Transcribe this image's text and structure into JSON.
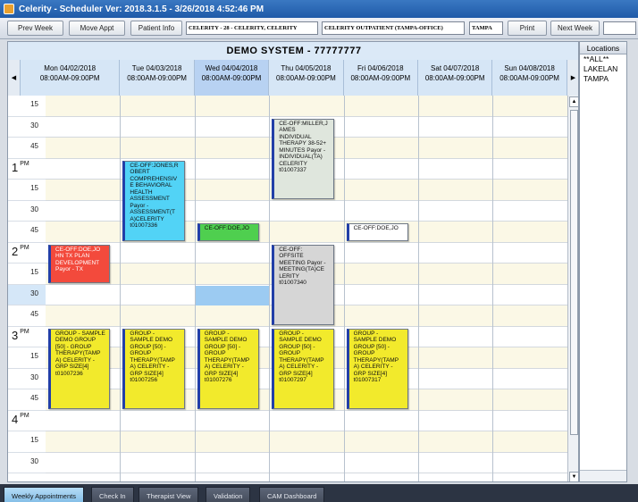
{
  "window": {
    "title": "Celerity - Scheduler Ver: 2018.3.1.5 - 3/26/2018 4:52:46 PM"
  },
  "toolbar": {
    "prev_week": "Prev Week",
    "move_appt": "Move Appt",
    "patient_info": "Patient Info",
    "patient_field": "CELERITY - 28 - CELERITY, CELERITY",
    "facility_field": "CELERITY OUTPATIENT (TAMPA-OFFICE)",
    "location_field": "TAMPA",
    "print": "Print",
    "next_week": "Next Week",
    "search_field": ""
  },
  "scheduler": {
    "system_title": "DEMO SYSTEM - 77777777",
    "days": [
      {
        "date": "Mon 04/02/2018",
        "hours": "08:00AM-09:00PM"
      },
      {
        "date": "Tue 04/03/2018",
        "hours": "08:00AM-09:00PM"
      },
      {
        "date": "Wed 04/04/2018",
        "hours": "08:00AM-09:00PM"
      },
      {
        "date": "Thu 04/05/2018",
        "hours": "08:00AM-09:00PM"
      },
      {
        "date": "Fri 04/06/2018",
        "hours": "08:00AM-09:00PM"
      },
      {
        "date": "Sat 04/07/2018",
        "hours": "08:00AM-09:00PM"
      },
      {
        "date": "Sun 04/08/2018",
        "hours": "08:00AM-09:00PM"
      }
    ],
    "time_slots": [
      {
        "hour": "",
        "ampm": "",
        "min": "15"
      },
      {
        "hour": "",
        "ampm": "",
        "min": "30"
      },
      {
        "hour": "",
        "ampm": "",
        "min": "45"
      },
      {
        "hour": "1",
        "ampm": "PM",
        "min": ""
      },
      {
        "hour": "",
        "ampm": "",
        "min": "15"
      },
      {
        "hour": "",
        "ampm": "",
        "min": "30"
      },
      {
        "hour": "",
        "ampm": "",
        "min": "45"
      },
      {
        "hour": "2",
        "ampm": "PM",
        "min": ""
      },
      {
        "hour": "",
        "ampm": "",
        "min": "15"
      },
      {
        "hour": "",
        "ampm": "",
        "min": "30"
      },
      {
        "hour": "",
        "ampm": "",
        "min": "45"
      },
      {
        "hour": "3",
        "ampm": "PM",
        "min": ""
      },
      {
        "hour": "",
        "ampm": "",
        "min": "15"
      },
      {
        "hour": "",
        "ampm": "",
        "min": "30"
      },
      {
        "hour": "",
        "ampm": "",
        "min": "45"
      },
      {
        "hour": "4",
        "ampm": "PM",
        "min": ""
      },
      {
        "hour": "",
        "ampm": "",
        "min": "15"
      },
      {
        "hour": "",
        "ampm": "",
        "min": "30"
      }
    ],
    "appointments": [
      {
        "id": "a1",
        "text": "CE-OFF:JONES,R\nOBERT\nCOMPREHENSIV\nE BEHAVIORAL\nHEALTH\nASSESSMENT\nPayor -\nASSESSMENT(T\nA)CELERITY\nt01007336",
        "color": "cyan"
      },
      {
        "id": "a2",
        "text": "CE-OFF:MILLER,J\nAMES\nINDIVIDUAL\nTHERAPY 38-52+\nMINUTES Payor -\nINDIVIDUAL(TA)\nCELERITY\nt01007337",
        "color": "graygreen"
      },
      {
        "id": "a3",
        "text": "CE-OFF:DOE,JO",
        "color": "green"
      },
      {
        "id": "a4",
        "text": "CE-OFF:DOE,JO",
        "color": "white"
      },
      {
        "id": "a5",
        "text": "CE-OFF:DOE,JO\nHN TX PLAN\nDEVELOPMENT\nPayor - TX",
        "color": "red"
      },
      {
        "id": "a6",
        "text": "CE-OFF:\nOFFSITE\nMEETING Payor -\nMEETING(TA)CE\nLERITY\nt01007340",
        "color": "gray"
      },
      {
        "id": "a7",
        "text": "GROUP - SAMPLE\nDEMO GROUP\n[50] - GROUP\nTHERAPY(TAMP\nA) CELERITY -\nGRP SIZE[4]\nt01007236",
        "color": "yellow"
      },
      {
        "id": "a8",
        "text": "GROUP -\nSAMPLE DEMO\nGROUP [50] -\nGROUP\nTHERAPY(TAMP\nA) CELERITY -\nGRP SIZE[4]\nt01007256",
        "color": "yellow"
      },
      {
        "id": "a9",
        "text": "GROUP -\nSAMPLE DEMO\nGROUP [50] -\nGROUP\nTHERAPY(TAMP\nA) CELERITY -\nGRP SIZE[4]\nt01007276",
        "color": "yellow"
      },
      {
        "id": "a10",
        "text": "GROUP -\nSAMPLE DEMO\nGROUP [50] -\nGROUP\nTHERAPY(TAMP\nA) CELERITY -\nGRP SIZE[4]\nt01007297",
        "color": "yellow"
      },
      {
        "id": "a11",
        "text": "GROUP -\nSAMPLE DEMO\nGROUP [50] -\nGROUP\nTHERAPY(TAMP\nA) CELERITY -\nGRP SIZE[4]\nt01007317",
        "color": "yellow"
      }
    ]
  },
  "locations": {
    "header": "Locations",
    "items": [
      "**ALL**",
      "LAKELAN",
      "TAMPA"
    ]
  },
  "tabs": [
    {
      "label": "Weekly Appointments"
    },
    {
      "label": "Check In"
    },
    {
      "label": "Therapist View"
    },
    {
      "label": "Validation"
    },
    {
      "label": "CAM Dashboard"
    }
  ],
  "colors": {
    "cyan": "#52d3f6",
    "green": "#4fcf4f",
    "red": "#f34a3c",
    "yellow": "#f2ea2c",
    "gray": "#d6d6d6",
    "graygreen": "#dfe6dd",
    "white": "#ffffff",
    "appt_border": "#223fa8"
  }
}
